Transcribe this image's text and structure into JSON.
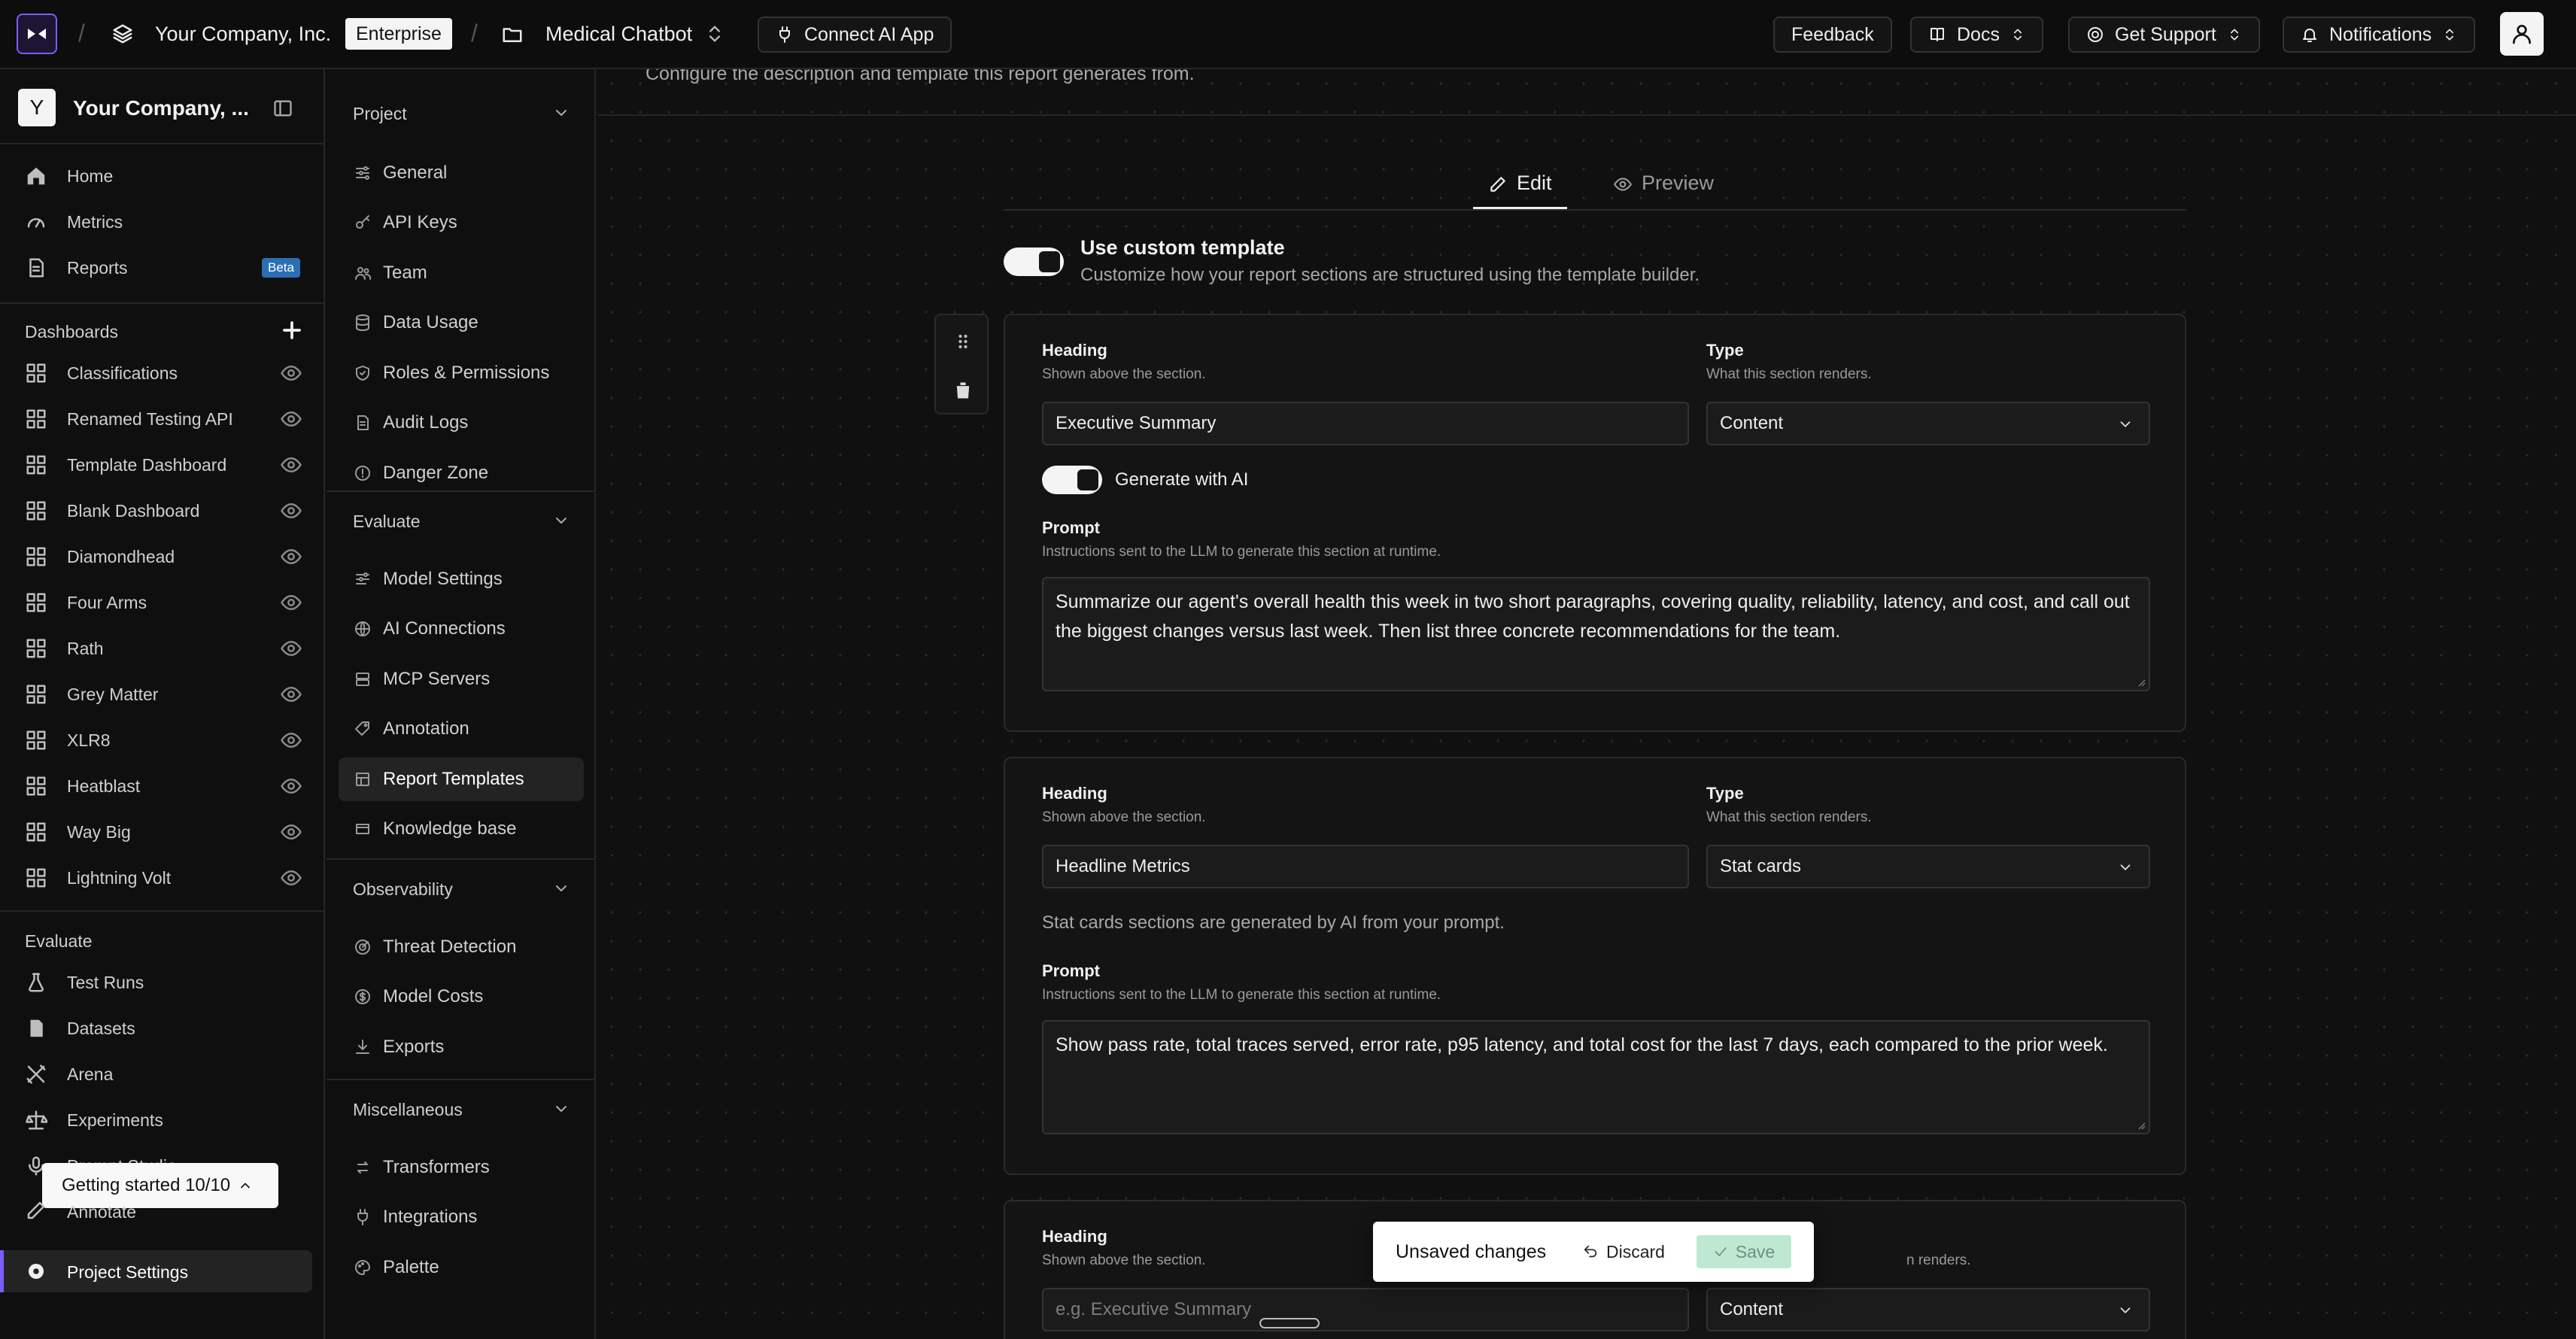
{
  "topbar": {
    "company": "Your Company, Inc.",
    "plan_badge": "Enterprise",
    "project": "Medical Chatbot",
    "connect": "Connect AI App",
    "feedback": "Feedback",
    "docs": "Docs",
    "support": "Get Support",
    "notifications": "Notifications"
  },
  "sidebar": {
    "workspace_initial": "Y",
    "workspace_name": "Your Company, ...",
    "main_items": [
      {
        "label": "Home",
        "icon": "home-icon"
      },
      {
        "label": "Metrics",
        "icon": "gauge-icon"
      },
      {
        "label": "Reports",
        "icon": "document-icon",
        "badge": "Beta"
      }
    ],
    "dashboards_label": "Dashboards",
    "dashboards": [
      "Classifications",
      "Renamed Testing API",
      "Template Dashboard",
      "Blank Dashboard",
      "Diamondhead",
      "Four Arms",
      "Rath",
      "Grey Matter",
      "XLR8",
      "Heatblast",
      "Way Big",
      "Lightning Volt"
    ],
    "evaluate_label": "Evaluate",
    "evaluate_items": [
      {
        "label": "Test Runs",
        "icon": "flask-icon"
      },
      {
        "label": "Datasets",
        "icon": "file-icon"
      },
      {
        "label": "Arena",
        "icon": "swords-icon"
      },
      {
        "label": "Experiments",
        "icon": "scale-icon"
      },
      {
        "label": "Prompt Studio",
        "icon": "mic-icon"
      },
      {
        "label": "Annotate",
        "icon": "annotate-icon"
      }
    ],
    "getting_started": "Getting started 10/10",
    "project_settings": "Project Settings"
  },
  "settings_nav": {
    "groups": [
      {
        "label": "Project",
        "items": [
          "General",
          "API Keys",
          "Team",
          "Data Usage",
          "Roles & Permissions",
          "Audit Logs",
          "Danger Zone"
        ]
      },
      {
        "label": "Evaluate",
        "items": [
          "Model Settings",
          "AI Connections",
          "MCP Servers",
          "Annotation",
          "Report Templates",
          "Knowledge base"
        ]
      },
      {
        "label": "Observability",
        "items": [
          "Threat Detection",
          "Model Costs",
          "Exports"
        ]
      },
      {
        "label": "Miscellaneous",
        "items": [
          "Transformers",
          "Integrations",
          "Palette"
        ]
      }
    ],
    "active": "Report Templates"
  },
  "main": {
    "description": "Configure the description and template this report generates from.",
    "tabs": {
      "edit": "Edit",
      "preview": "Preview"
    },
    "custom_template": {
      "title": "Use custom template",
      "subtitle": "Customize how your report sections are structured using the template builder.",
      "enabled": true
    },
    "section_labels": {
      "heading": "Heading",
      "heading_hint": "Shown above the section.",
      "type": "Type",
      "type_hint": "What this section renders.",
      "prompt": "Prompt",
      "prompt_hint": "Instructions sent to the LLM to generate this section at runtime.",
      "generate_ai": "Generate with AI"
    },
    "sections": [
      {
        "heading": "Executive Summary",
        "type": "Content",
        "generate_with_ai": true,
        "prompt": "Summarize our agent's overall health this week in two short paragraphs, covering quality, reliability, latency, and cost, and call out the biggest changes versus last week. Then list three concrete recommendations for the team."
      },
      {
        "heading": "Headline Metrics",
        "type": "Stat cards",
        "note": "Stat cards sections are generated by AI from your prompt.",
        "prompt": "Show pass rate, total traces served, error rate, p95 latency, and total cost for the last 7 days, each compared to the prior week."
      },
      {
        "heading_placeholder": "e.g. Executive Summary",
        "type": "Content",
        "type_hint_partial": "n renders."
      }
    ]
  },
  "toast": {
    "text": "Unsaved changes",
    "discard": "Discard",
    "save": "Save"
  }
}
